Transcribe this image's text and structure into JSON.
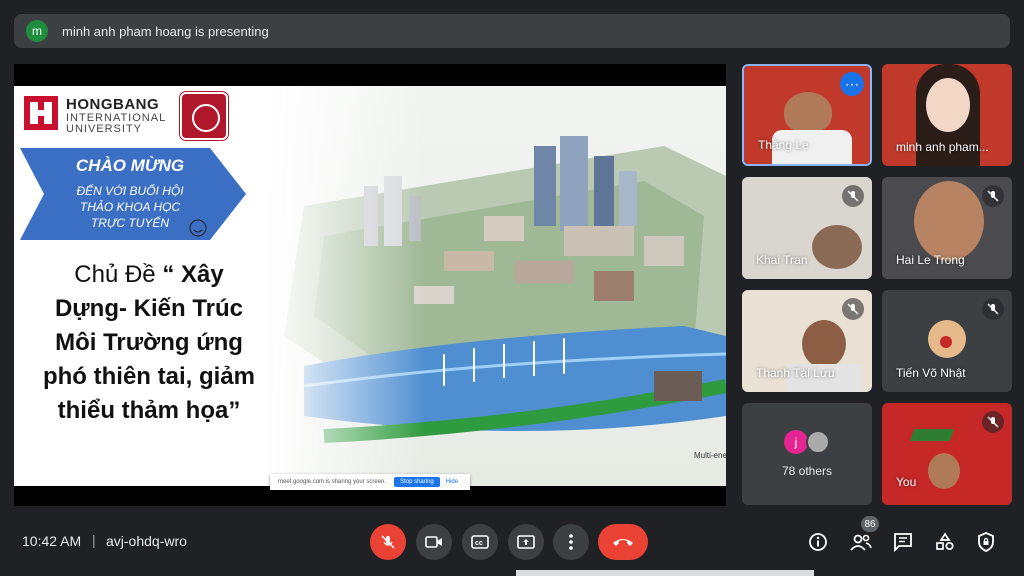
{
  "banner": {
    "avatar_letter": "m",
    "text": "minh anh pham hoang is presenting"
  },
  "slide": {
    "university_line1": "HONGBANG",
    "university_line2": "INTERNATIONAL",
    "university_line3": "UNIVERSITY",
    "welcome_title": "CHÀO MỪNG",
    "welcome_line1": "ĐẾN VỚI BUỔI HỘI",
    "welcome_line2": "THẢO KHOA HỌC",
    "welcome_line3": "TRỰC TUYẾN",
    "topic_line1_prefix": "Chủ Đề ",
    "topic_line1_bold": "“ Xây",
    "topic_line2": "Dựng-  Kiến Trúc",
    "topic_line3": "Môi Trường ứng",
    "topic_line4": "phó thiên tai, giảm",
    "topic_line5": "thiểu thảm họa”",
    "city_caption": "Multi-energy st",
    "share_toast": {
      "text": "meet.google.com is sharing your screen.",
      "stop_label": "Stop sharing",
      "hide_label": "Hide"
    }
  },
  "participants": [
    {
      "name": "Thắng Le"
    },
    {
      "name": "minh anh pham..."
    },
    {
      "name": "Khai Tran"
    },
    {
      "name": "Hai Le Trong"
    },
    {
      "name": "Thanh Tài Lưu"
    },
    {
      "name": "Tiến Võ Nhật"
    },
    {
      "name": "You"
    }
  ],
  "others": {
    "avatar_letter": "j",
    "label": "78 others"
  },
  "bottom_bar": {
    "time": "10:42 AM",
    "separator": "|",
    "meeting_code": "avj-ohdq-wro",
    "people_count": "86"
  },
  "colors": {
    "background": "#202124",
    "tile": "#3c4043",
    "danger": "#ea4335",
    "accent": "#1a73e8"
  }
}
